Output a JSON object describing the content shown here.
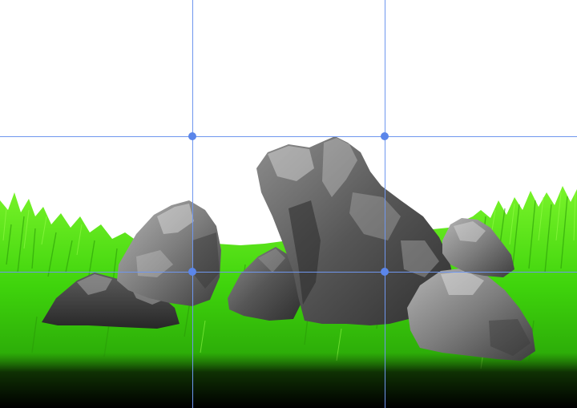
{
  "scene": {
    "subject": "rocks-on-grass",
    "colors": {
      "background": "#ffffff",
      "grass_light": "#6cf01c",
      "grass_mid": "#38c80a",
      "grass_dark": "#1c8a06",
      "soil_shadow": "#000000",
      "rock_light": "#c9c9c9",
      "rock_mid": "#7a7a7a",
      "rock_dark": "#2e2e2e",
      "guide": "#6f96ee",
      "handle": "#5b86ea"
    }
  },
  "overlay": {
    "type": "rule-of-thirds-grid",
    "columns": 3,
    "rows": 3,
    "handles": 4
  }
}
